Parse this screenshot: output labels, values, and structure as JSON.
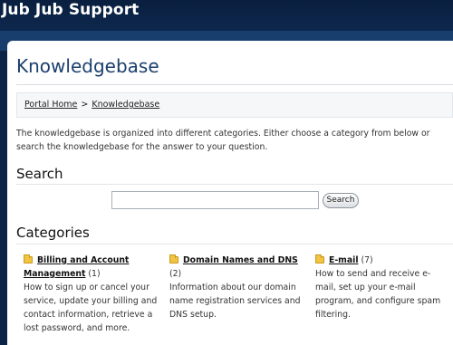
{
  "header": {
    "site_title": "Jub Jub Support"
  },
  "page": {
    "title": "Knowledgebase",
    "breadcrumb": {
      "home": "Portal Home",
      "separator": ">",
      "current": "Knowledgebase"
    },
    "intro": "The knowledgebase is organized into different categories. Either choose a category from below or search the knowledgebase for the answer to your question."
  },
  "search": {
    "heading": "Search",
    "input_value": "",
    "button_label": "Search"
  },
  "categories": {
    "heading": "Categories",
    "items": [
      {
        "name": "Billing and Account Management",
        "count": "(1)",
        "description": "How to sign up or cancel your service, update your billing and contact information, retrieve a lost password, and more."
      },
      {
        "name": "Domain Names and DNS",
        "count": "(2)",
        "description": "Information about our domain name registration services and DNS setup."
      },
      {
        "name": "E-mail",
        "count": "(7)",
        "description": "How to send and receive e-mail, set up your e-mail program, and configure spam filtering."
      }
    ]
  },
  "colors": {
    "header_bg": "#0b2347",
    "title_blue": "#1b3f6d",
    "folder": "#f1c442"
  },
  "icons": {
    "category": "folder-icon"
  }
}
